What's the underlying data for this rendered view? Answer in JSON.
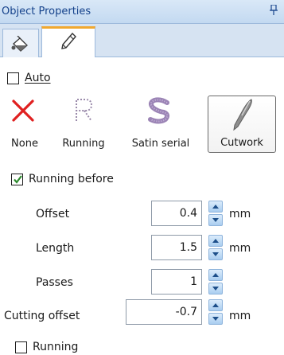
{
  "panel": {
    "title": "Object Properties",
    "pin_icon": "pin-icon"
  },
  "tabs": [
    {
      "icon": "fill-bucket-icon",
      "active": false
    },
    {
      "icon": "pen-nib-icon",
      "active": true
    }
  ],
  "auto": {
    "label": "Auto",
    "checked": false
  },
  "modes": [
    {
      "label": "None",
      "icon": "red-x-icon",
      "selected": false
    },
    {
      "label": "Running",
      "icon": "running-stitch-r-icon",
      "selected": false
    },
    {
      "label": "Satin serial",
      "icon": "satin-serial-s-icon",
      "selected": false
    },
    {
      "label": "Cutwork",
      "icon": "cutwork-blade-icon",
      "selected": true
    }
  ],
  "running_before": {
    "label": "Running before",
    "checked": true,
    "offset": {
      "label": "Offset",
      "value": "0.4",
      "unit": "mm"
    },
    "length": {
      "label": "Length",
      "value": "1.5",
      "unit": "mm"
    },
    "passes": {
      "label": "Passes",
      "value": "1"
    }
  },
  "cutting_offset": {
    "label": "Cutting offset",
    "value": "-0.7",
    "unit": "mm"
  },
  "running_after": {
    "label": "Running",
    "checked": false
  },
  "colors": {
    "accent_tab": "#f0a830",
    "title_text": "#15428b",
    "check": "#2e8b2e",
    "x_red": "#e02020"
  }
}
